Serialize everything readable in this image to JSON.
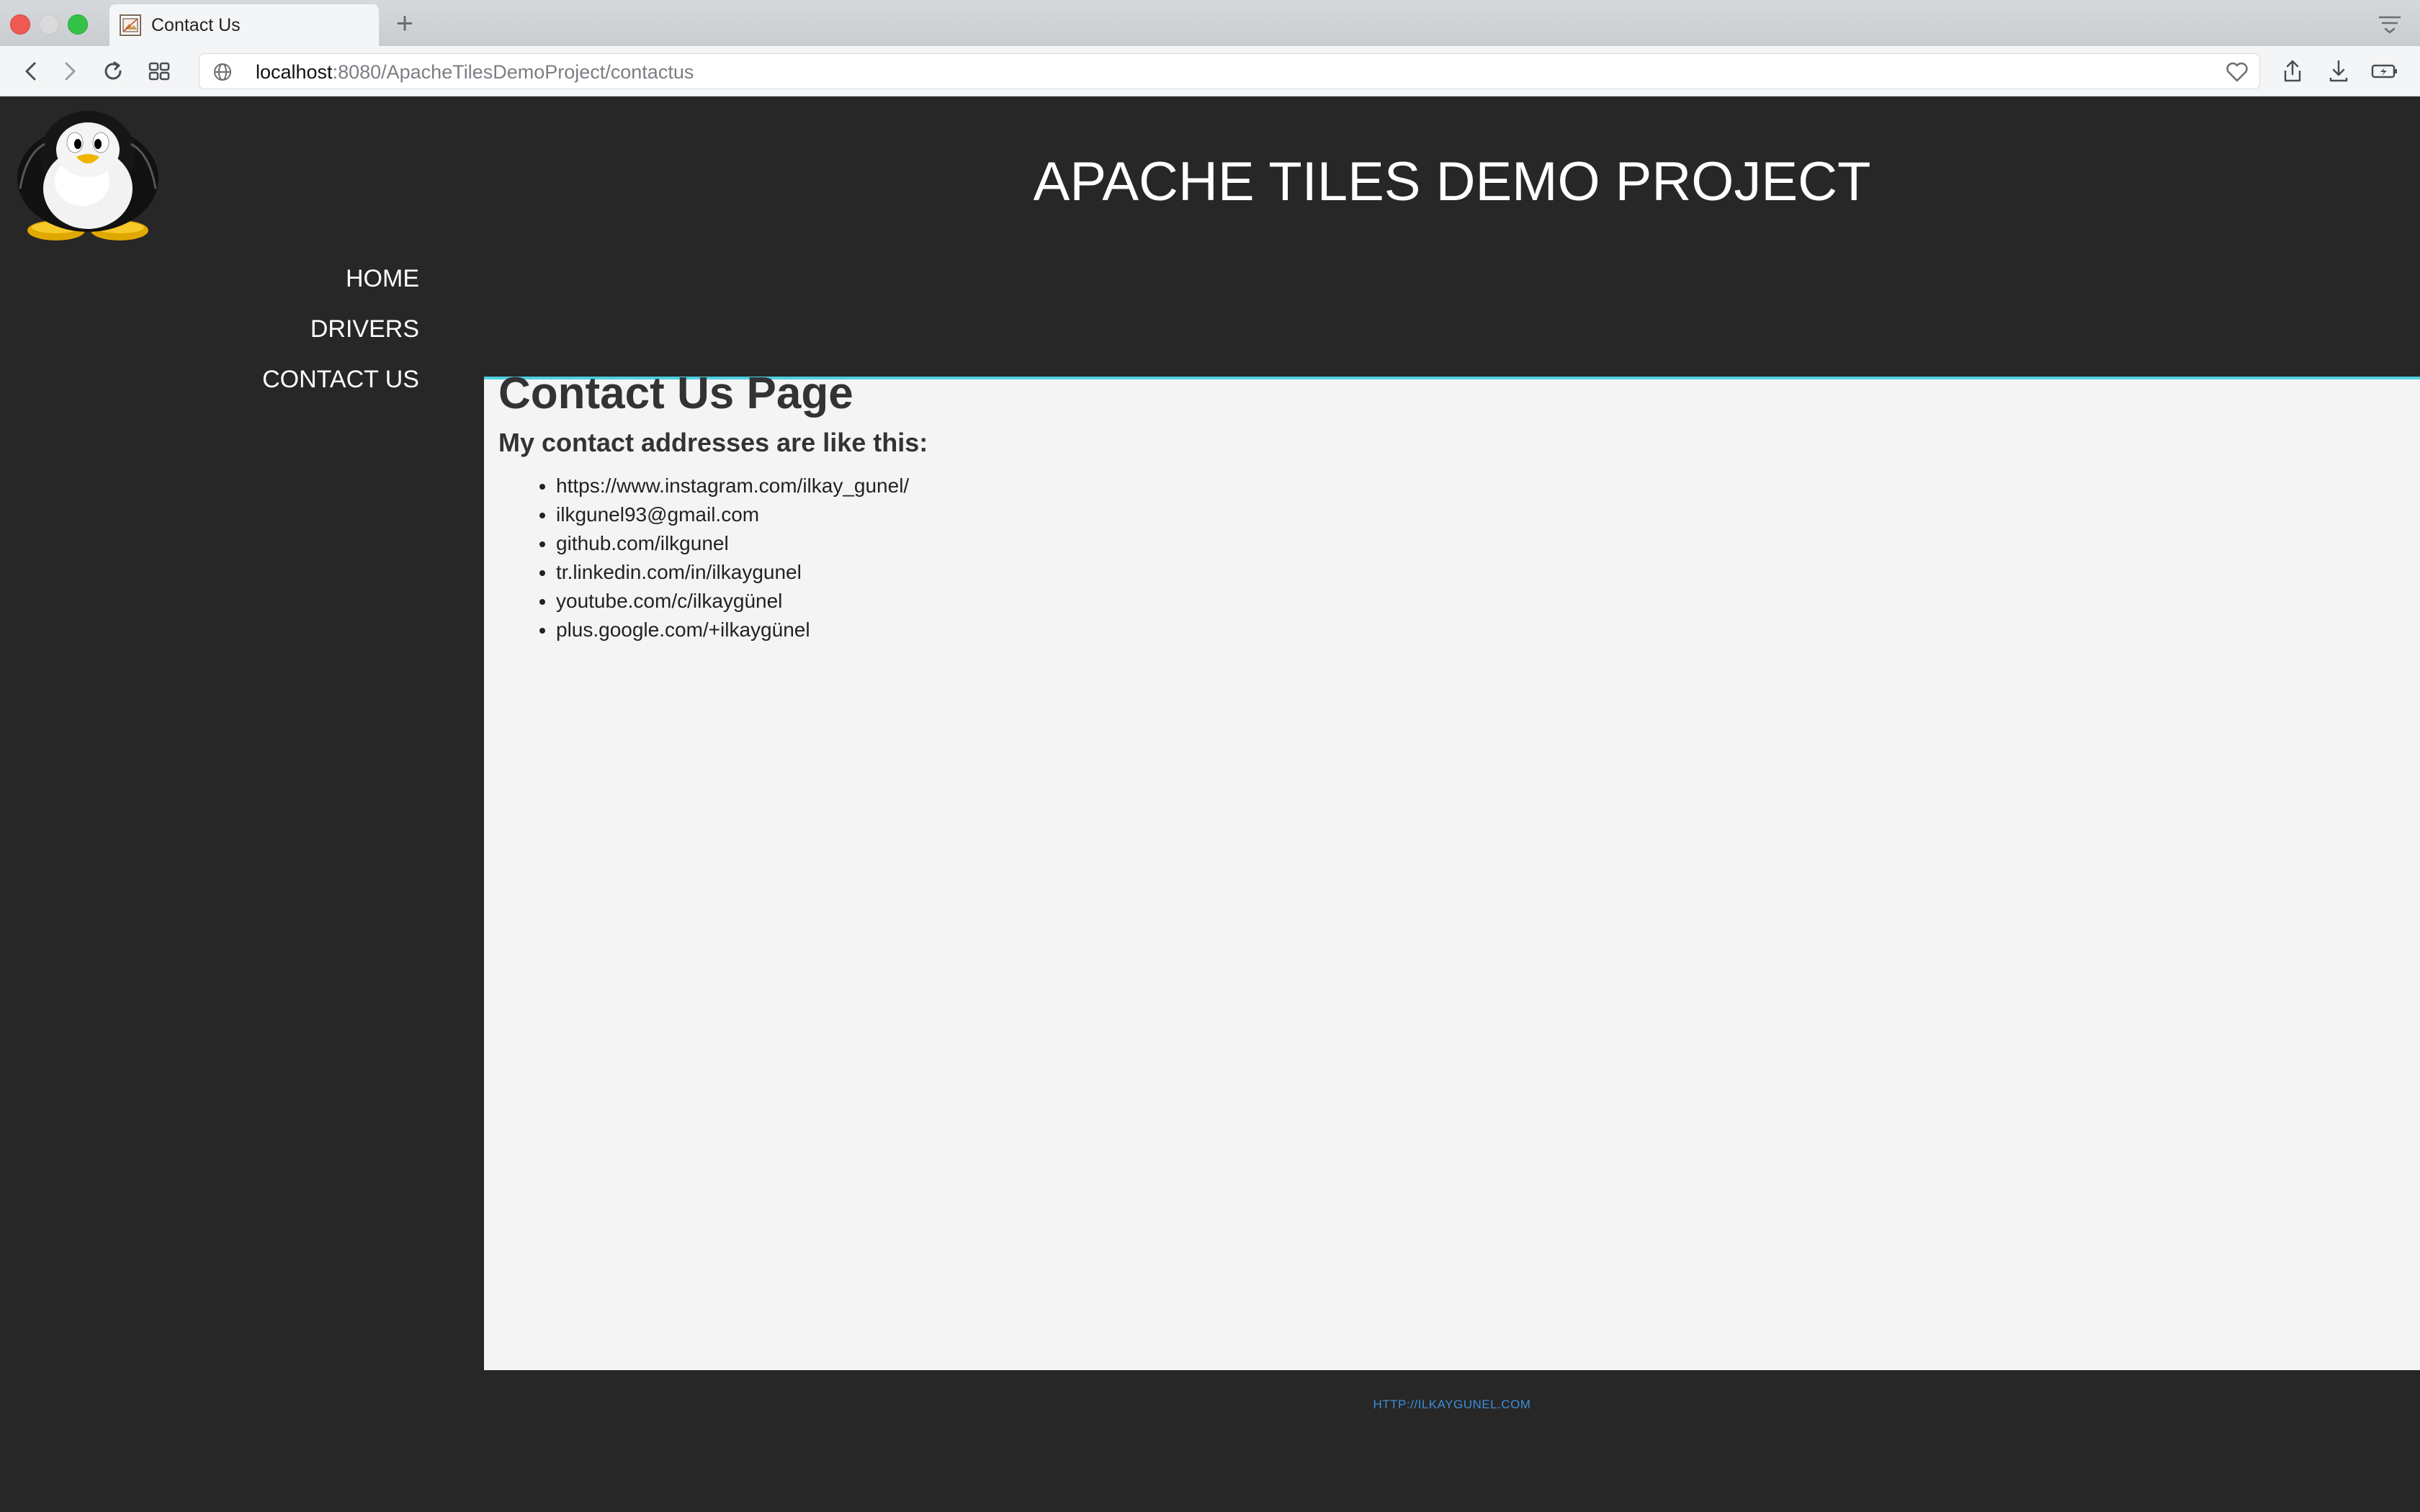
{
  "browser": {
    "tab_title": "Contact Us",
    "new_tab_symbol": "+",
    "url_host": "localhost",
    "url_rest": ":8080/ApacheTilesDemoProject/contactus",
    "icons": [
      "back-icon",
      "forward-icon",
      "reload-icon",
      "tab-overview-icon",
      "globe-icon",
      "heart-icon",
      "share-icon",
      "download-icon",
      "battery-icon",
      "tabs-menu-icon"
    ]
  },
  "site": {
    "title": "APACHE TILES DEMO PROJECT",
    "logo": "penguin-logo"
  },
  "nav": {
    "items": [
      {
        "label": "HOME"
      },
      {
        "label": "DRIVERS"
      },
      {
        "label": "CONTACT US"
      }
    ]
  },
  "content": {
    "heading": "Contact Us Page",
    "subheading": "My contact addresses are like this:",
    "contacts": [
      "https://www.instagram.com/ilkay_gunel/",
      "ilkgunel93@gmail.com",
      "github.com/ilkgunel",
      "tr.linkedin.com/in/ilkaygunel",
      "youtube.com/c/ilkaygünel",
      "plus.google.com/+ilkaygünel"
    ]
  },
  "footer": {
    "link": "HTTP://ILKAYGUNEL.COM"
  },
  "colors": {
    "dark_bg": "#272727",
    "content_bg": "#f4f4f4",
    "accent_line": "#4dd0e1",
    "footer_link": "#3d8ed8"
  }
}
